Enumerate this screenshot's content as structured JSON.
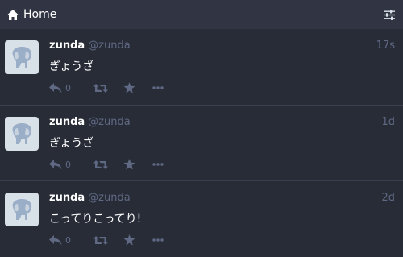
{
  "header": {
    "title": "Home",
    "home_icon": "home-icon",
    "settings_icon": "sliders-icon"
  },
  "colors": {
    "background": "#282c37",
    "header": "#313543",
    "muted": "#606984",
    "divider": "#393f4f",
    "avatar_bg": "#d9e1e8",
    "mascot": "#9baec8"
  },
  "statuses": [
    {
      "display_name": "zunda",
      "acct": "@zunda",
      "time": "17s",
      "content": "ぎょうざ",
      "replies": "0"
    },
    {
      "display_name": "zunda",
      "acct": "@zunda",
      "time": "1d",
      "content": "ぎょうざ",
      "replies": "0"
    },
    {
      "display_name": "zunda",
      "acct": "@zunda",
      "time": "2d",
      "content": "こってりこってり!",
      "replies": "0"
    }
  ]
}
